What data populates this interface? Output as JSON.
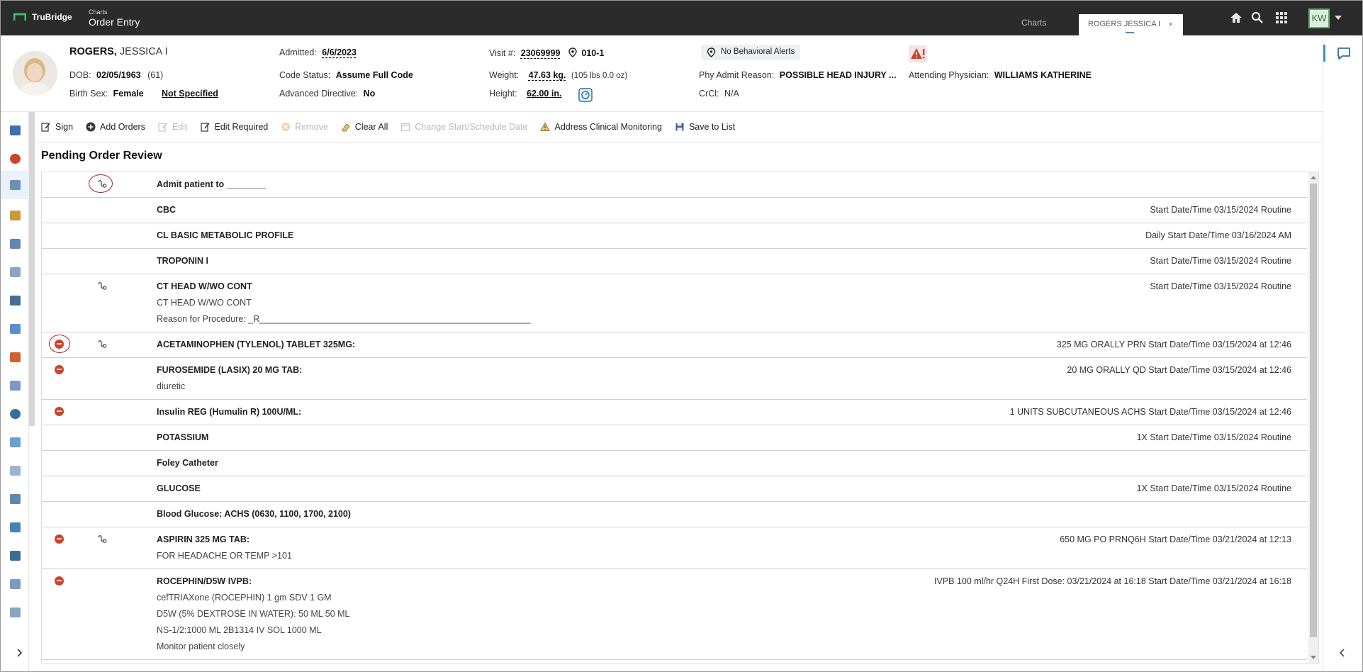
{
  "topbar": {
    "brand": "TruBridge",
    "crumb_small": "Charts",
    "crumb_title": "Order Entry",
    "tabs": [
      {
        "label": "Charts"
      },
      {
        "label": "ROGERS JESSICA I"
      }
    ],
    "close_glyph": "×",
    "user_initials": "KW",
    "icons": [
      "home-icon",
      "search-icon",
      "apps-grid-icon"
    ]
  },
  "patient": {
    "last_name": "ROGERS,",
    "first_name": "JESSICA I",
    "dob_label": "DOB:",
    "dob": "02/05/1963",
    "age": "(61)",
    "birth_sex_label": "Birth Sex:",
    "birth_sex": "Female",
    "gender_identity": "Not Specified",
    "admitted_label": "Admitted:",
    "admitted": "6/6/2023",
    "code_status_label": "Code Status:",
    "code_status": "Assume Full Code",
    "adv_directive_label": "Advanced Directive:",
    "adv_directive": "No",
    "visit_label": "Visit #:",
    "visit": "23069999",
    "room": "010-1",
    "weight_label": "Weight:",
    "weight": "47.63 kg.",
    "weight_alt": "(105 lbs 0.0 oz)",
    "height_label": "Height:",
    "height": "62.00 in.",
    "behavioral_alerts": "No Behavioral Alerts",
    "phy_admit_reason_label": "Phy Admit Reason:",
    "phy_admit_reason": "POSSIBLE HEAD INJURY ...",
    "crcl_label": "CrCl:",
    "crcl": "N/A",
    "attending_label": "Attending Physician:",
    "attending": "WILLIAMS KATHERINE"
  },
  "toolbar": {
    "sign": "Sign",
    "add_orders": "Add Orders",
    "edit": "Edit",
    "edit_required": "Edit Required",
    "remove": "Remove",
    "clear_all": "Clear All",
    "change_start": "Change Start/Schedule Date",
    "address_monitoring": "Address Clinical Monitoring",
    "save_to_list": "Save to List"
  },
  "section_title": "Pending Order Review",
  "orders": [
    {
      "title": "Admit patient to ________",
      "subs": [],
      "right": "",
      "stop": false,
      "cosign": true,
      "stop_circled": false,
      "cosign_circled": true
    },
    {
      "title": "CBC",
      "subs": [],
      "right": "Start Date/Time 03/15/2024 Routine",
      "stop": false,
      "cosign": false
    },
    {
      "title": "CL BASIC METABOLIC PROFILE",
      "subs": [],
      "right": "Daily Start Date/Time 03/16/2024 AM",
      "stop": false,
      "cosign": false
    },
    {
      "title": "TROPONIN I",
      "subs": [],
      "right": "Start Date/Time 03/15/2024 Routine",
      "stop": false,
      "cosign": false
    },
    {
      "title": "CT HEAD W/WO CONT",
      "subs": [
        "CT HEAD W/WO CONT",
        "Reason for Procedure: _R_______________________________________________________"
      ],
      "right": "Start Date/Time 03/15/2024 Routine",
      "stop": false,
      "cosign": true
    },
    {
      "title": "ACETAMINOPHEN (TYLENOL) TABLET 325MG:",
      "subs": [],
      "right": "325 MG ORALLY PRN Start Date/Time 03/15/2024 at 12:46",
      "stop": true,
      "cosign": true,
      "stop_circled": true
    },
    {
      "title": "FUROSEMIDE (LASIX) 20 MG TAB:",
      "subs": [
        "diuretic"
      ],
      "right": "20 MG ORALLY QD Start Date/Time 03/15/2024 at 12:46",
      "stop": true,
      "cosign": false
    },
    {
      "title": "Insulin REG (Humulin R) 100U/ML:",
      "subs": [],
      "right": "1 UNITS SUBCUTANEOUS ACHS Start Date/Time 03/15/2024 at 12:46",
      "stop": true,
      "cosign": false
    },
    {
      "title": "POTASSIUM",
      "subs": [],
      "right": "1X Start Date/Time 03/15/2024 Routine",
      "stop": false,
      "cosign": false
    },
    {
      "title": "Foley Catheter",
      "subs": [],
      "right": "",
      "stop": false,
      "cosign": false
    },
    {
      "title": "GLUCOSE",
      "subs": [],
      "right": "1X Start Date/Time 03/15/2024 Routine",
      "stop": false,
      "cosign": false
    },
    {
      "title": "Blood Glucose: ACHS (0630, 1100, 1700, 2100)",
      "subs": [],
      "right": "",
      "stop": false,
      "cosign": false
    },
    {
      "title": "ASPIRIN 325 MG TAB:",
      "subs": [
        "FOR HEADACHE OR TEMP >101"
      ],
      "right": "650 MG PO PRNQ6H Start Date/Time 03/21/2024 at 12:13",
      "stop": true,
      "cosign": true
    },
    {
      "title": "ROCEPHIN/D5W IVPB:",
      "subs": [
        "cefTRIAXone (ROCEPHIN) 1 gm SDV 1 GM",
        "D5W (5% DEXTROSE IN WATER): 50 ML 50 ML",
        "NS-1/2:1000 ML 2B1314 IV SOL 1000 ML",
        "Monitor patient closely"
      ],
      "right": "IVPB 100 ml/hr Q24H First Dose: 03/21/2024 at 16:18 Start Date/Time 03/21/2024 at 16:18",
      "stop": true,
      "cosign": false
    }
  ],
  "colors": {
    "topbar": "#2b2b2b",
    "stop_badge": "#c8452e",
    "annotation_ring": "#a1221c",
    "accent": "#3a8fd6"
  }
}
